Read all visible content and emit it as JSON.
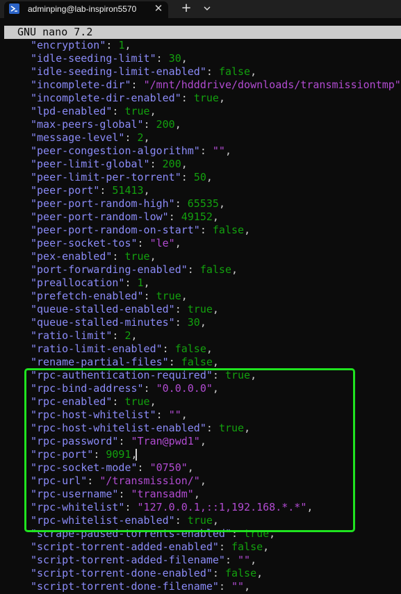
{
  "window": {
    "tab_title": "adminping@lab-inspiron5570",
    "tab_close_icon": "close-icon",
    "new_tab_icon": "plus-icon",
    "dropdown_icon": "chevron-down-icon",
    "shell_icon": "powershell-icon"
  },
  "editor": {
    "title": "GNU nano 7.2",
    "lines": [
      {
        "key": "\"encryption\"",
        "sep": ": ",
        "value": "1",
        "vtype": "n"
      },
      {
        "key": "\"idle-seeding-limit\"",
        "sep": ": ",
        "value": "30",
        "vtype": "n"
      },
      {
        "key": "\"idle-seeding-limit-enabled\"",
        "sep": ": ",
        "value": "false",
        "vtype": "n"
      },
      {
        "key": "\"incomplete-dir\"",
        "sep": ": ",
        "value": "\"/mnt/hdddrive/downloads/transmissiontmp\"",
        "vtype": "s"
      },
      {
        "key": "\"incomplete-dir-enabled\"",
        "sep": ": ",
        "value": "true",
        "vtype": "n"
      },
      {
        "key": "\"lpd-enabled\"",
        "sep": ": ",
        "value": "true",
        "vtype": "n"
      },
      {
        "key": "\"max-peers-global\"",
        "sep": ": ",
        "value": "200",
        "vtype": "n"
      },
      {
        "key": "\"message-level\"",
        "sep": ": ",
        "value": "2",
        "vtype": "n"
      },
      {
        "key": "\"peer-congestion-algorithm\"",
        "sep": ": ",
        "value": "\"\"",
        "vtype": "s"
      },
      {
        "key": "\"peer-limit-global\"",
        "sep": ": ",
        "value": "200",
        "vtype": "n"
      },
      {
        "key": "\"peer-limit-per-torrent\"",
        "sep": ": ",
        "value": "50",
        "vtype": "n"
      },
      {
        "key": "\"peer-port\"",
        "sep": ": ",
        "value": "51413",
        "vtype": "n"
      },
      {
        "key": "\"peer-port-random-high\"",
        "sep": ": ",
        "value": "65535",
        "vtype": "n"
      },
      {
        "key": "\"peer-port-random-low\"",
        "sep": ": ",
        "value": "49152",
        "vtype": "n"
      },
      {
        "key": "\"peer-port-random-on-start\"",
        "sep": ": ",
        "value": "false",
        "vtype": "n"
      },
      {
        "key": "\"peer-socket-tos\"",
        "sep": ": ",
        "value": "\"le\"",
        "vtype": "s"
      },
      {
        "key": "\"pex-enabled\"",
        "sep": ": ",
        "value": "true",
        "vtype": "n"
      },
      {
        "key": "\"port-forwarding-enabled\"",
        "sep": ": ",
        "value": "false",
        "vtype": "n"
      },
      {
        "key": "\"preallocation\"",
        "sep": ": ",
        "value": "1",
        "vtype": "n"
      },
      {
        "key": "\"prefetch-enabled\"",
        "sep": ": ",
        "value": "true",
        "vtype": "n"
      },
      {
        "key": "\"queue-stalled-enabled\"",
        "sep": ": ",
        "value": "true",
        "vtype": "n"
      },
      {
        "key": "\"queue-stalled-minutes\"",
        "sep": ": ",
        "value": "30",
        "vtype": "n"
      },
      {
        "key": "\"ratio-limit\"",
        "sep": ": ",
        "value": "2",
        "vtype": "n"
      },
      {
        "key": "\"ratio-limit-enabled\"",
        "sep": ": ",
        "value": "false",
        "vtype": "n"
      },
      {
        "key": "\"rename-partial-files\"",
        "sep": ": ",
        "value": "false",
        "vtype": "n"
      },
      {
        "key": "\"rpc-authentication-required\"",
        "sep": ": ",
        "value": "true",
        "vtype": "n"
      },
      {
        "key": "\"rpc-bind-address\"",
        "sep": ": ",
        "value": "\"0.0.0.0\"",
        "vtype": "s"
      },
      {
        "key": "\"rpc-enabled\"",
        "sep": ": ",
        "value": "true",
        "vtype": "n"
      },
      {
        "key": "\"rpc-host-whitelist\"",
        "sep": ": ",
        "value": "\"\"",
        "vtype": "s"
      },
      {
        "key": "\"rpc-host-whitelist-enabled\"",
        "sep": ": ",
        "value": "true",
        "vtype": "n"
      },
      {
        "key": "\"rpc-password\"",
        "sep": ": ",
        "value": "\"Tran@pwd1\"",
        "vtype": "s"
      },
      {
        "key": "\"rpc-port\"",
        "sep": ": ",
        "value": "9091",
        "vtype": "n"
      },
      {
        "key": "\"rpc-socket-mode\"",
        "sep": ": ",
        "value": "\"0750\"",
        "vtype": "s"
      },
      {
        "key": "\"rpc-url\"",
        "sep": ": ",
        "value": "\"/transmission/\"",
        "vtype": "s"
      },
      {
        "key": "\"rpc-username\"",
        "sep": ": ",
        "value": "\"transadm\"",
        "vtype": "s"
      },
      {
        "key": "\"rpc-whitelist\"",
        "sep": ": ",
        "value": "\"127.0.0.1,::1,192.168.*.*\"",
        "vtype": "s"
      },
      {
        "key": "\"rpc-whitelist-enabled\"",
        "sep": ": ",
        "value": "true",
        "vtype": "n"
      },
      {
        "key": "\"scrape-paused-torrents-enabled\"",
        "sep": ": ",
        "value": "true",
        "vtype": "n"
      },
      {
        "key": "\"script-torrent-added-enabled\"",
        "sep": ": ",
        "value": "false",
        "vtype": "n"
      },
      {
        "key": "\"script-torrent-added-filename\"",
        "sep": ": ",
        "value": "\"\"",
        "vtype": "s"
      },
      {
        "key": "\"script-torrent-done-enabled\"",
        "sep": ": ",
        "value": "false",
        "vtype": "n"
      },
      {
        "key": "\"script-torrent-done-filename\"",
        "sep": ": ",
        "value": "\"\"",
        "vtype": "s"
      }
    ],
    "comma": ",",
    "highlight_color": "#1fe31f",
    "colors": {
      "key": "#8b8bf7",
      "number": "#13a10e",
      "string": "#b14bd1",
      "punct": "#cccccc"
    }
  }
}
